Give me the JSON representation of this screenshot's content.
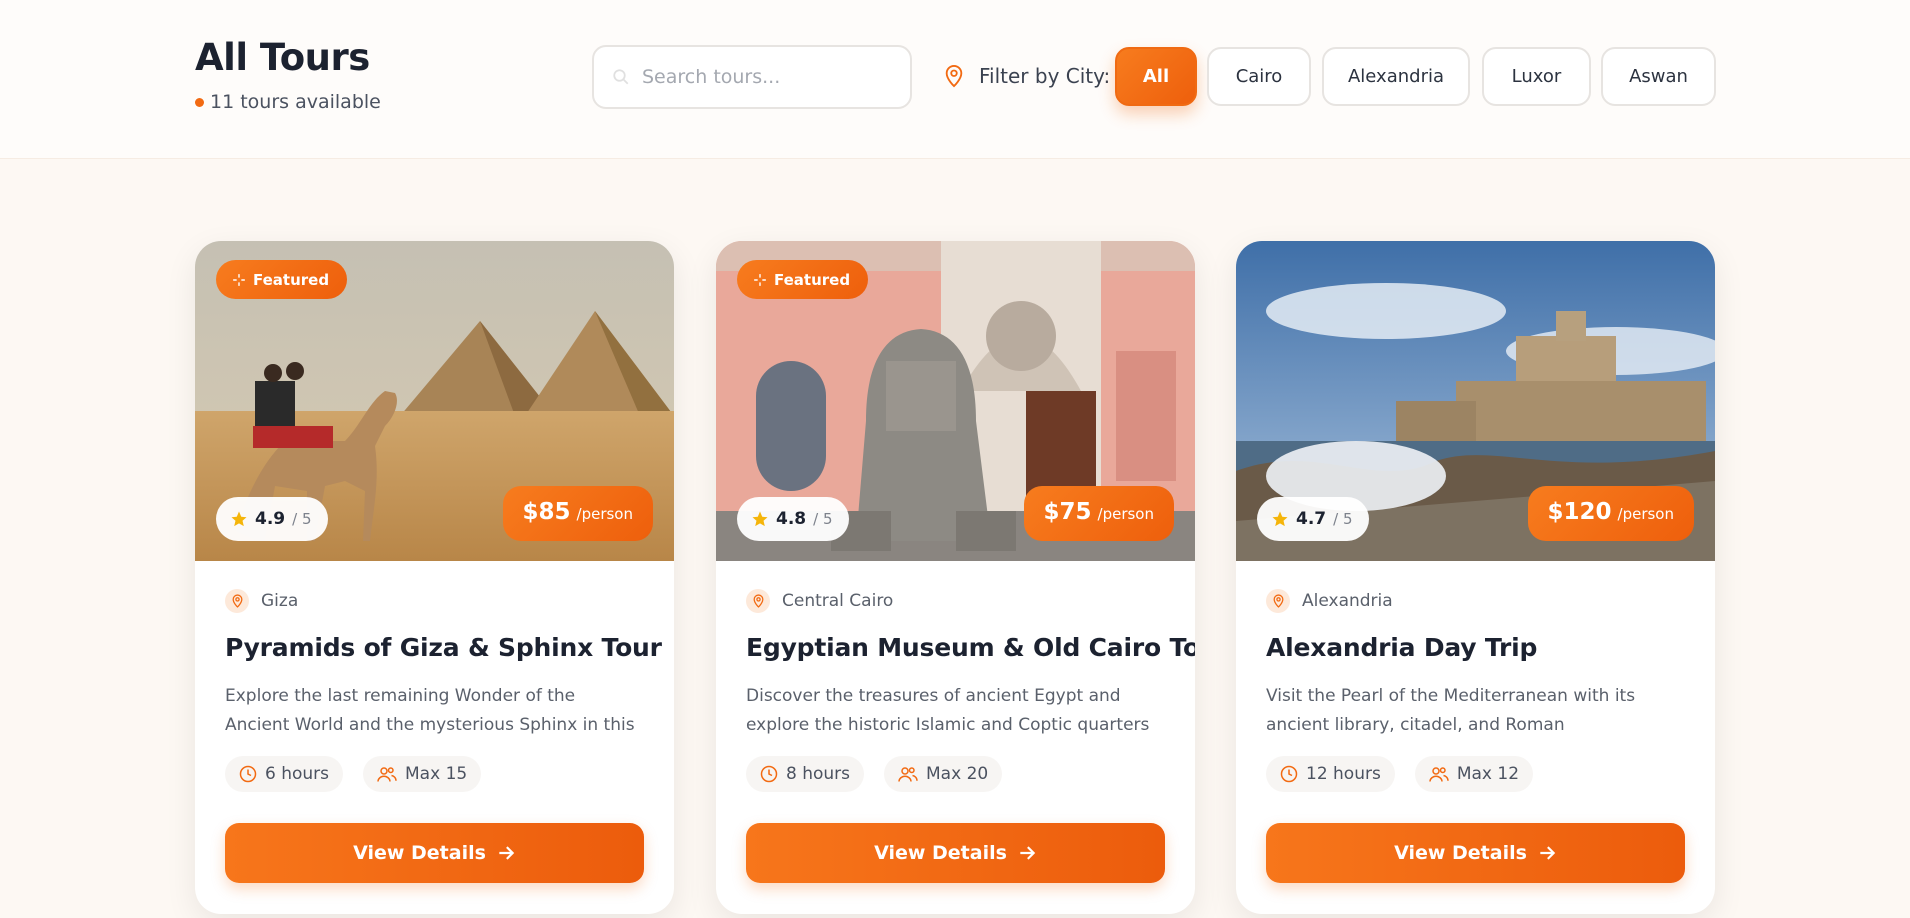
{
  "header": {
    "title": "All Tours",
    "count_text": "11 tours available",
    "search_placeholder": "Search tours...",
    "filter_label": "Filter by City:",
    "cities": [
      "All",
      "Cairo",
      "Alexandria",
      "Luxor",
      "Aswan"
    ],
    "active_city": "All"
  },
  "colors": {
    "accent": "#f26a12",
    "text": "#1c2230",
    "muted": "#5a606b"
  },
  "tours": [
    {
      "featured": true,
      "featured_label": "Featured",
      "rating": "4.9",
      "rating_max": "/ 5",
      "price": "$85",
      "price_unit": "/person",
      "location": "Giza",
      "title": "Pyramids of Giza & Sphinx Tour",
      "description": "Explore the last remaining Wonder of the Ancient World and the mysterious Sphinx in this half-day...",
      "duration": "6 hours",
      "group": "Max 15",
      "button": "View Details"
    },
    {
      "featured": true,
      "featured_label": "Featured",
      "rating": "4.8",
      "rating_max": "/ 5",
      "price": "$75",
      "price_unit": "/person",
      "location": "Central Cairo",
      "title": "Egyptian Museum & Old Cairo Tour",
      "description": "Discover the treasures of ancient Egypt and explore the historic Islamic and Coptic quarters of Old Cairo.",
      "duration": "8 hours",
      "group": "Max 20",
      "button": "View Details"
    },
    {
      "featured": false,
      "rating": "4.7",
      "rating_max": "/ 5",
      "price": "$120",
      "price_unit": "/person",
      "location": "Alexandria",
      "title": "Alexandria Day Trip",
      "description": "Visit the Pearl of the Mediterranean with its ancient library, citadel, and Roman amphitheater.",
      "duration": "12 hours",
      "group": "Max 12",
      "button": "View Details"
    }
  ]
}
